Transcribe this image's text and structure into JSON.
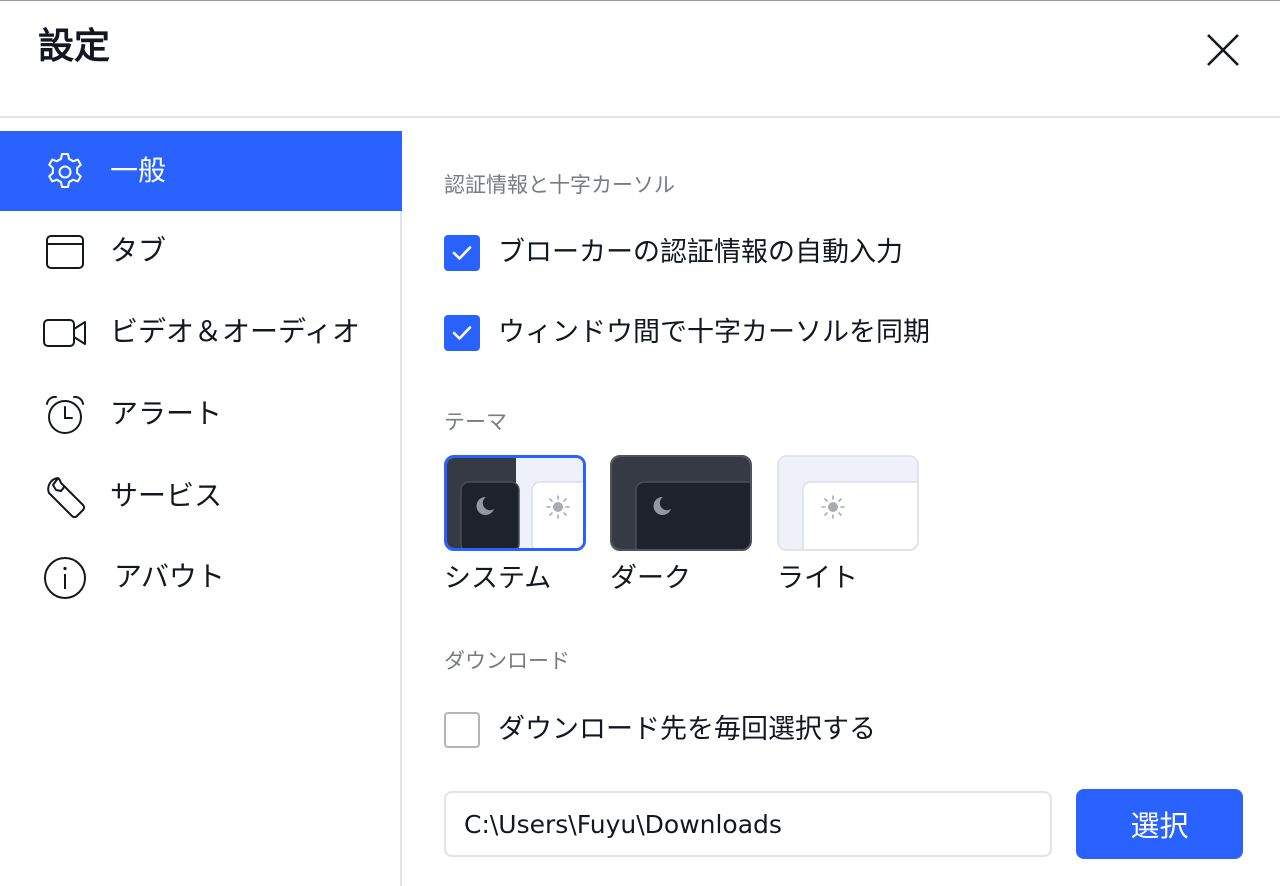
{
  "window": {
    "title": "設定"
  },
  "sidebar": {
    "items": [
      {
        "label": "一般",
        "icon": "gear-icon",
        "active": true
      },
      {
        "label": "タブ",
        "icon": "window-icon",
        "active": false
      },
      {
        "label": "ビデオ＆オーディオ",
        "icon": "video-camera-icon",
        "active": false
      },
      {
        "label": "アラート",
        "icon": "alarm-clock-icon",
        "active": false
      },
      {
        "label": "サービス",
        "icon": "wrench-icon",
        "active": false
      },
      {
        "label": "アバウト",
        "icon": "info-icon",
        "active": false
      }
    ]
  },
  "general": {
    "credentials": {
      "title": "認証情報と十字カーソル",
      "auto_fill": {
        "label": "ブローカーの認証情報の自動入力",
        "checked": true
      },
      "sync_crosshair": {
        "label": "ウィンドウ間で十字カーソルを同期",
        "checked": true
      }
    },
    "theme": {
      "title": "テーマ",
      "options": [
        {
          "label": "システム",
          "selected": true
        },
        {
          "label": "ダーク",
          "selected": false
        },
        {
          "label": "ライト",
          "selected": false
        }
      ]
    },
    "download": {
      "title": "ダウンロード",
      "ask_location": {
        "label": "ダウンロード先を毎回選択する",
        "checked": false
      },
      "path_value": "C:\\Users\\Fuyu\\Downloads",
      "select_label": "選択"
    }
  },
  "colors": {
    "accent": "#2962ff",
    "text": "#131722",
    "muted": "#787b86",
    "border": "#e0e3eb",
    "dark_bg": "#363a45",
    "dark_panel": "#1e222d",
    "light_bg": "#eef1f9"
  }
}
